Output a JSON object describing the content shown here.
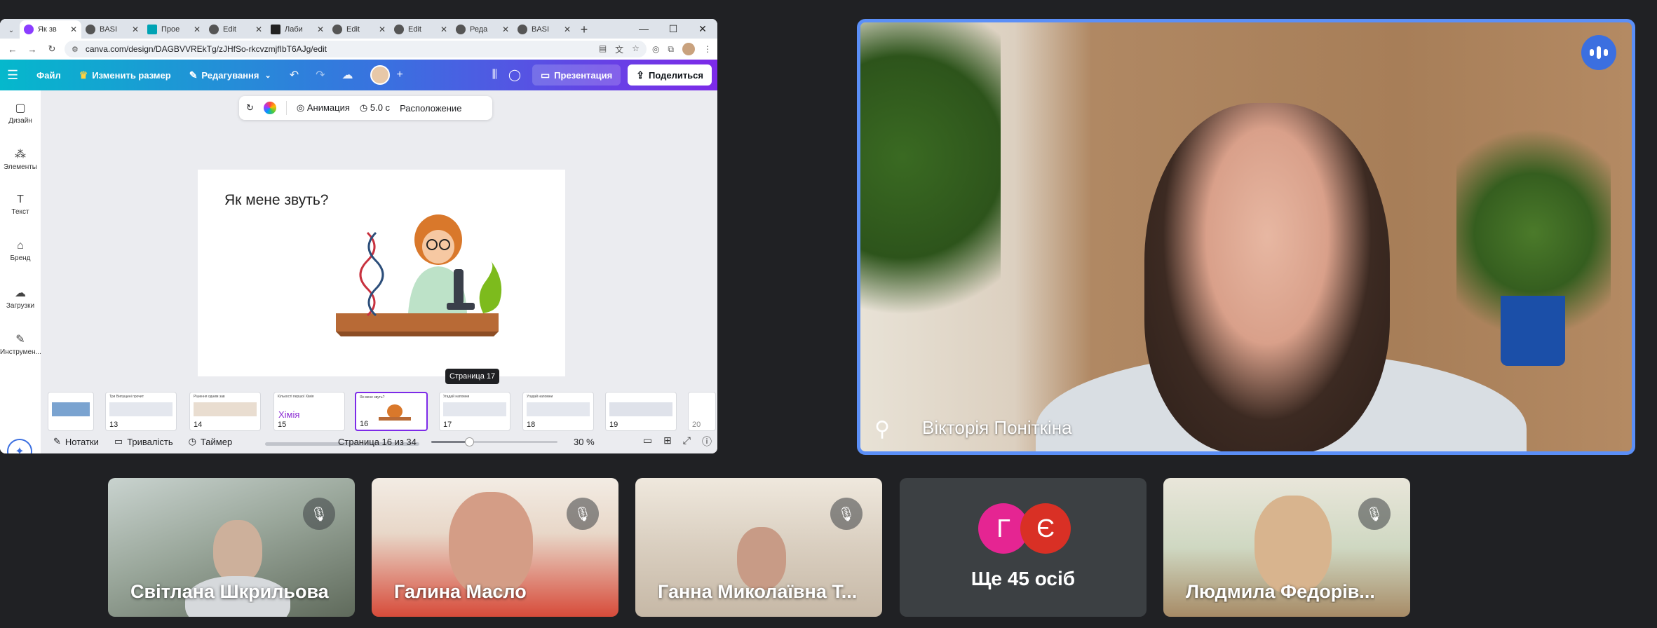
{
  "browser": {
    "tabs": [
      {
        "label": "Як зв",
        "color": "#8b3dff",
        "active": true
      },
      {
        "label": "BASI",
        "color": "#333333"
      },
      {
        "label": "Прое",
        "color": "#00a3b4"
      },
      {
        "label": "Edit",
        "color": "#333333"
      },
      {
        "label": "Лаби",
        "color": "#222222"
      },
      {
        "label": "Edit",
        "color": "#333333"
      },
      {
        "label": "Edit",
        "color": "#333333"
      },
      {
        "label": "Реда",
        "color": "#333333"
      },
      {
        "label": "BASI",
        "color": "#333333"
      }
    ],
    "url": "canva.com/design/DAGBVVREkTg/zJHfSo-rkcvzmjfIbT6AJg/edit"
  },
  "canva": {
    "header": {
      "file": "Файл",
      "resize": "Изменить размер",
      "editing": "Редагування",
      "present": "Презентация",
      "share": "Поделиться"
    },
    "rail": [
      "Дизайн",
      "Элементы",
      "Текст",
      "Бренд",
      "Загрузки",
      "Инструмен..."
    ],
    "toolbar": {
      "animation": "Анимация",
      "duration": "5.0 с",
      "position": "Расположение"
    },
    "slide_title": "Як мене звуть?",
    "tooltip": "Страница 17",
    "thumbnails": [
      {
        "num": "13",
        "title": "Три Випущені прочит"
      },
      {
        "num": "14",
        "title": "Рішення одним зав"
      },
      {
        "num": "15",
        "title": "Кількості першої Хімія",
        "label": "Хімія"
      },
      {
        "num": "16",
        "title": "Як мене звуть?",
        "selected": true
      },
      {
        "num": "17",
        "title": "Угадай напомни"
      },
      {
        "num": "18",
        "title": "Угадай напомни"
      },
      {
        "num": "19",
        "title": ""
      },
      {
        "num": "20",
        "title": ""
      }
    ],
    "footer": {
      "notes": "Нотатки",
      "duration": "Тривалість",
      "timer": "Таймер",
      "page_counter": "Страница 16 из 34",
      "zoom": "30 %",
      "zoom_fraction": 0.3
    }
  },
  "meet": {
    "speaker": {
      "name": "Вікторія Поніткіна"
    },
    "tiles": [
      {
        "name": "Світлана Шкрильова",
        "muted": true
      },
      {
        "name": "Галина Масло",
        "muted": true
      },
      {
        "name": "Ганна Миколаївна Т...",
        "muted": true
      },
      {
        "name": "Людмила Федорів...",
        "muted": true
      }
    ],
    "others": {
      "text": "Ще 45 осіб",
      "initials": [
        "Г",
        "Є"
      ],
      "colors": [
        "#e52592",
        "#d93025"
      ]
    }
  }
}
